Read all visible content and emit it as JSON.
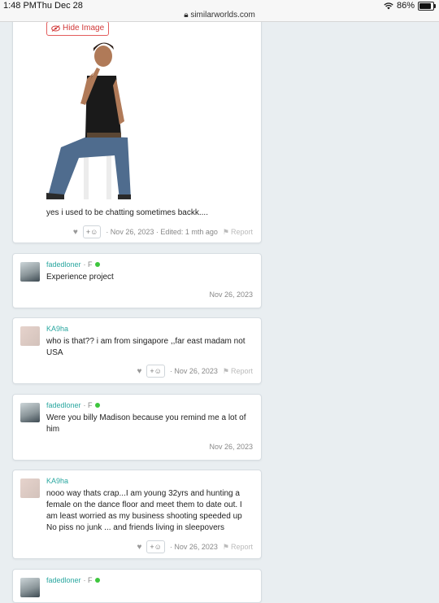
{
  "status_bar": {
    "time": "1:48 PM",
    "day": "Thu Dec 28",
    "url": "similarworlds.com",
    "battery": "86%",
    "battery_level": 0.86
  },
  "first_post": {
    "hide_image_label": "Hide Image",
    "text": "yes i used to be chatting sometimes backk....",
    "react_label": "+☺",
    "meta": "· Nov 26, 2023 · Edited: 1 mth ago",
    "report_label": "Report"
  },
  "comments": [
    {
      "user": "fadedloner",
      "gender": "· F",
      "online": true,
      "text": "Experience project",
      "date": "Nov 26, 2023"
    },
    {
      "user": "KA9ha",
      "gender": "",
      "online": false,
      "text": "who is that?? i am from singapore ,,far east madam not USA",
      "react_label": "+☺",
      "date": "· Nov 26, 2023",
      "report_label": "Report"
    },
    {
      "user": "fadedloner",
      "gender": "· F",
      "online": true,
      "text": "Were you billy Madison because you remind me a lot of him",
      "date": "Nov 26, 2023"
    },
    {
      "user": "KA9ha",
      "gender": "",
      "online": false,
      "text": "nooo way thats crap...I am young 32yrs and hunting a female on the dance floor and meet them to date out. I am least worried as my business shooting speeded up No piss no junk ... and friends living in sleepovers",
      "react_label": "+☺",
      "date": "· Nov 26, 2023",
      "report_label": "Report"
    },
    {
      "user": "fadedloner",
      "gender": "· F",
      "online": true
    }
  ]
}
